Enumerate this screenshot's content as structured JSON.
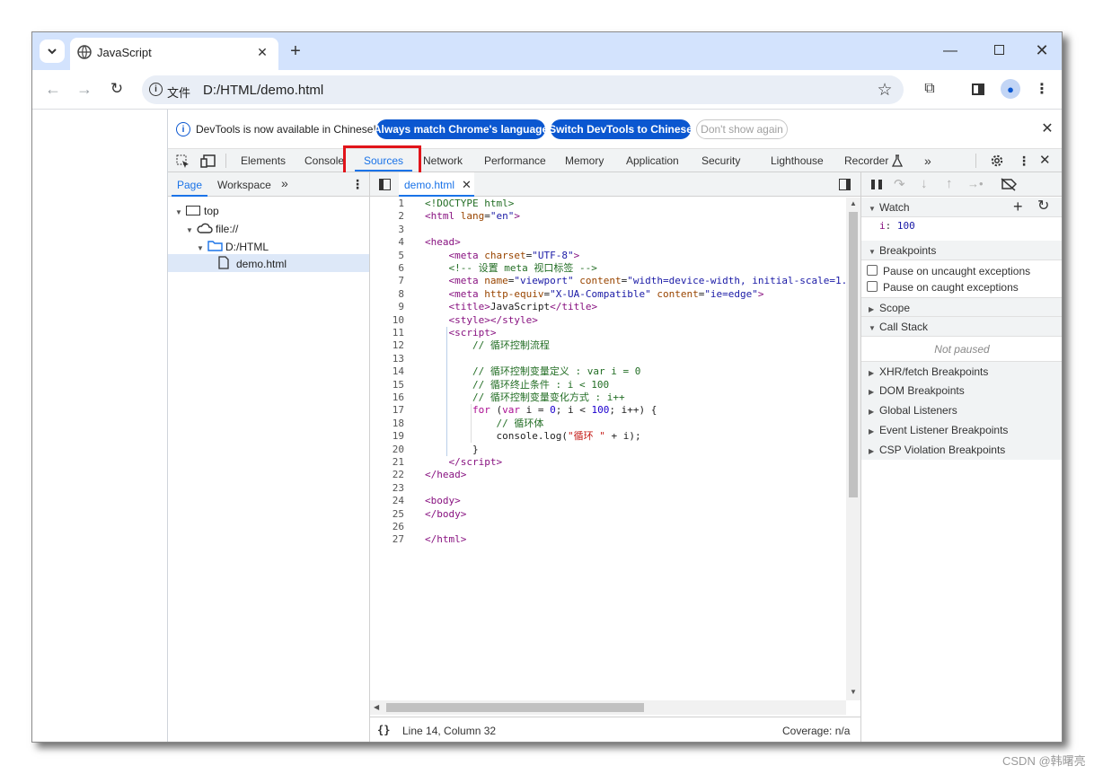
{
  "browser": {
    "tab_title": "JavaScript",
    "new_tab": "+",
    "address_chip": "文件",
    "url": "D:/HTML/demo.html"
  },
  "infobar": {
    "message": "DevTools is now available in Chinese!",
    "btn_match": "Always match Chrome's language",
    "btn_switch": "Switch DevTools to Chinese",
    "btn_dont": "Don't show again"
  },
  "main_tabs": {
    "elements": "Elements",
    "console": "Console",
    "sources": "Sources",
    "network": "Network",
    "performance": "Performance",
    "memory": "Memory",
    "application": "Application",
    "security": "Security",
    "lighthouse": "Lighthouse",
    "recorder": "Recorder"
  },
  "navigator": {
    "tab_page": "Page",
    "tab_workspace": "Workspace",
    "tree": {
      "top": "top",
      "file": "file://",
      "folder": "D:/HTML",
      "document": "demo.html"
    }
  },
  "editor": {
    "file_tab": "demo.html",
    "status_position": "Line 14, Column 32",
    "status_coverage": "Coverage: n/a",
    "line_numbers": [
      "1",
      "2",
      "3",
      "4",
      "5",
      "6",
      "7",
      "8",
      "9",
      "10",
      "11",
      "12",
      "13",
      "14",
      "15",
      "16",
      "17",
      "18",
      "19",
      "20",
      "21",
      "22",
      "23",
      "24",
      "25",
      "26",
      "27"
    ]
  },
  "debugger": {
    "watch": {
      "title": "Watch",
      "expr_name": "i",
      "expr_value": "100"
    },
    "breakpoints": {
      "title": "Breakpoints",
      "pause_uncaught": "Pause on uncaught exceptions",
      "pause_caught": "Pause on caught exceptions"
    },
    "scope": "Scope",
    "call_stack": {
      "title": "Call Stack",
      "status": "Not paused"
    },
    "xhr": "XHR/fetch Breakpoints",
    "dom": "DOM Breakpoints",
    "global": "Global Listeners",
    "event": "Event Listener Breakpoints",
    "csp": "CSP Violation Breakpoints"
  },
  "watermark": "CSDN @韩曙亮",
  "colors": {
    "tabstrip": "#d3e3fd",
    "primary_button": "#0b57d0",
    "selected_tab": "#1a73e8",
    "highlight_box": "#e1141a"
  }
}
